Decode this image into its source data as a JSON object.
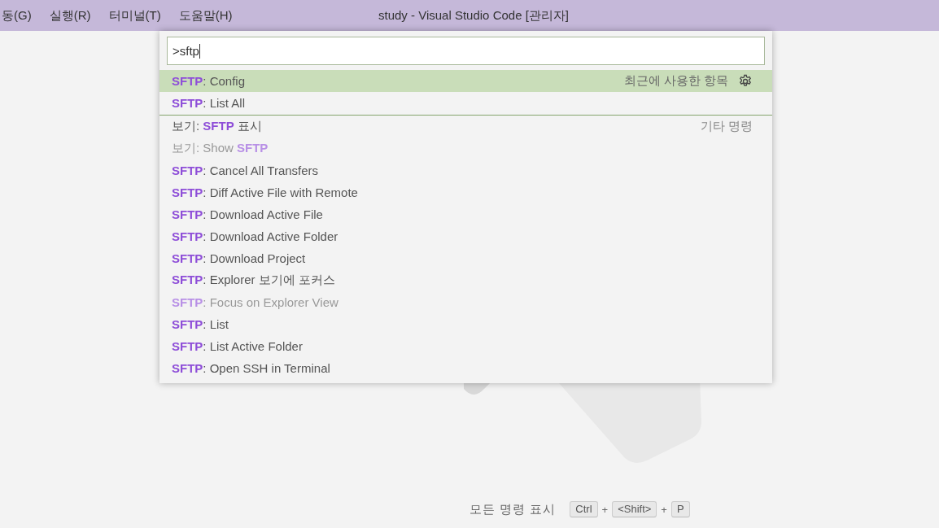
{
  "menu_bar": {
    "items": [
      "동(G)",
      "실행(R)",
      "터미널(T)",
      "도움말(H)"
    ]
  },
  "window": {
    "title": "study - Visual Studio Code [관리자]"
  },
  "command_palette": {
    "input": {
      "value": ">sftp"
    },
    "items": [
      {
        "label": "**SFTP**: Config",
        "selected": true,
        "dimmed": false,
        "group_label": "최근에 사용한 항목",
        "separator_before": false,
        "gear": true
      },
      {
        "label": "**SFTP**: List All",
        "selected": false,
        "dimmed": false,
        "separator_before": false,
        "gear": false
      },
      {
        "label": "보기: **SFTP** 표시",
        "selected": false,
        "dimmed": false,
        "group_label": "기타 명령",
        "separator_before": true,
        "gear": false
      },
      {
        "label": "보기: Show **SFTP**",
        "selected": false,
        "dimmed": true,
        "separator_before": false,
        "gear": false
      },
      {
        "label": "**SFTP**: Cancel All Transfers",
        "selected": false,
        "dimmed": false,
        "separator_before": false,
        "gear": false
      },
      {
        "label": "**SFTP**: Diff Active File with Remote",
        "selected": false,
        "dimmed": false,
        "separator_before": false,
        "gear": false
      },
      {
        "label": "**SFTP**: Download Active File",
        "selected": false,
        "dimmed": false,
        "separator_before": false,
        "gear": false
      },
      {
        "label": "**SFTP**: Download Active Folder",
        "selected": false,
        "dimmed": false,
        "separator_before": false,
        "gear": false
      },
      {
        "label": "**SFTP**: Download Project",
        "selected": false,
        "dimmed": false,
        "separator_before": false,
        "gear": false
      },
      {
        "label": "**SFTP**: Explorer 보기에 포커스",
        "selected": false,
        "dimmed": false,
        "separator_before": false,
        "gear": false
      },
      {
        "label": "**SFTP**: Focus on Explorer View",
        "selected": false,
        "dimmed": true,
        "separator_before": false,
        "gear": false
      },
      {
        "label": "**SFTP**: List",
        "selected": false,
        "dimmed": false,
        "separator_before": false,
        "gear": false
      },
      {
        "label": "**SFTP**: List Active Folder",
        "selected": false,
        "dimmed": false,
        "separator_before": false,
        "gear": false
      },
      {
        "label": "**SFTP**: Open SSH in Terminal",
        "selected": false,
        "dimmed": false,
        "separator_before": false,
        "gear": false
      }
    ]
  },
  "shortcut_hint": {
    "label": "모든 명령 표시",
    "keys": [
      "Ctrl",
      "<Shift>",
      "P"
    ],
    "joiners": [
      "+",
      "+"
    ]
  }
}
